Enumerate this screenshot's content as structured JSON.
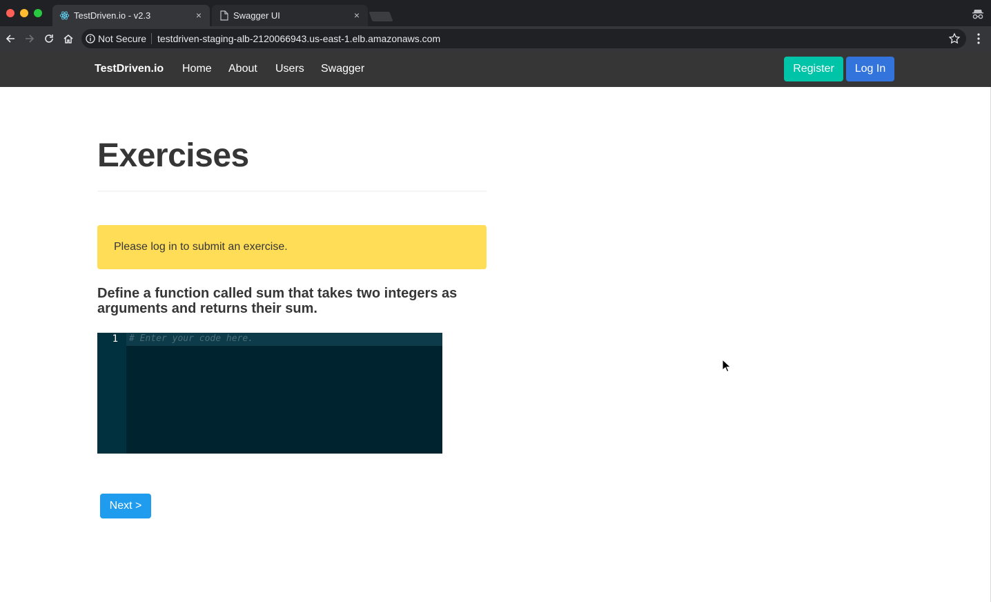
{
  "browser": {
    "tabs": [
      {
        "title": "TestDriven.io - v2.3",
        "icon": "react-atom-icon",
        "close": "×"
      },
      {
        "title": "Swagger UI",
        "icon": "document-icon",
        "close": "×"
      }
    ],
    "security_label": "Not Secure",
    "url": "testdriven-staging-alb-2120066943.us-east-1.elb.amazonaws.com"
  },
  "navbar": {
    "brand": "TestDriven.io",
    "links": [
      "Home",
      "About",
      "Users",
      "Swagger"
    ],
    "register_label": "Register",
    "login_label": "Log In"
  },
  "main": {
    "title": "Exercises",
    "notice": "Please log in to submit an exercise.",
    "exercise_body": "Define a function called sum that takes two integers as arguments and returns their sum.",
    "editor": {
      "line_number": "1",
      "placeholder": "# Enter your code here."
    },
    "next_label": "Next >"
  },
  "colors": {
    "navbar_bg": "#363636",
    "register": "#00c4a7",
    "login": "#3273dc",
    "notice_bg": "#ffdd57",
    "editor_bg": "#002330",
    "next": "#209cee"
  }
}
